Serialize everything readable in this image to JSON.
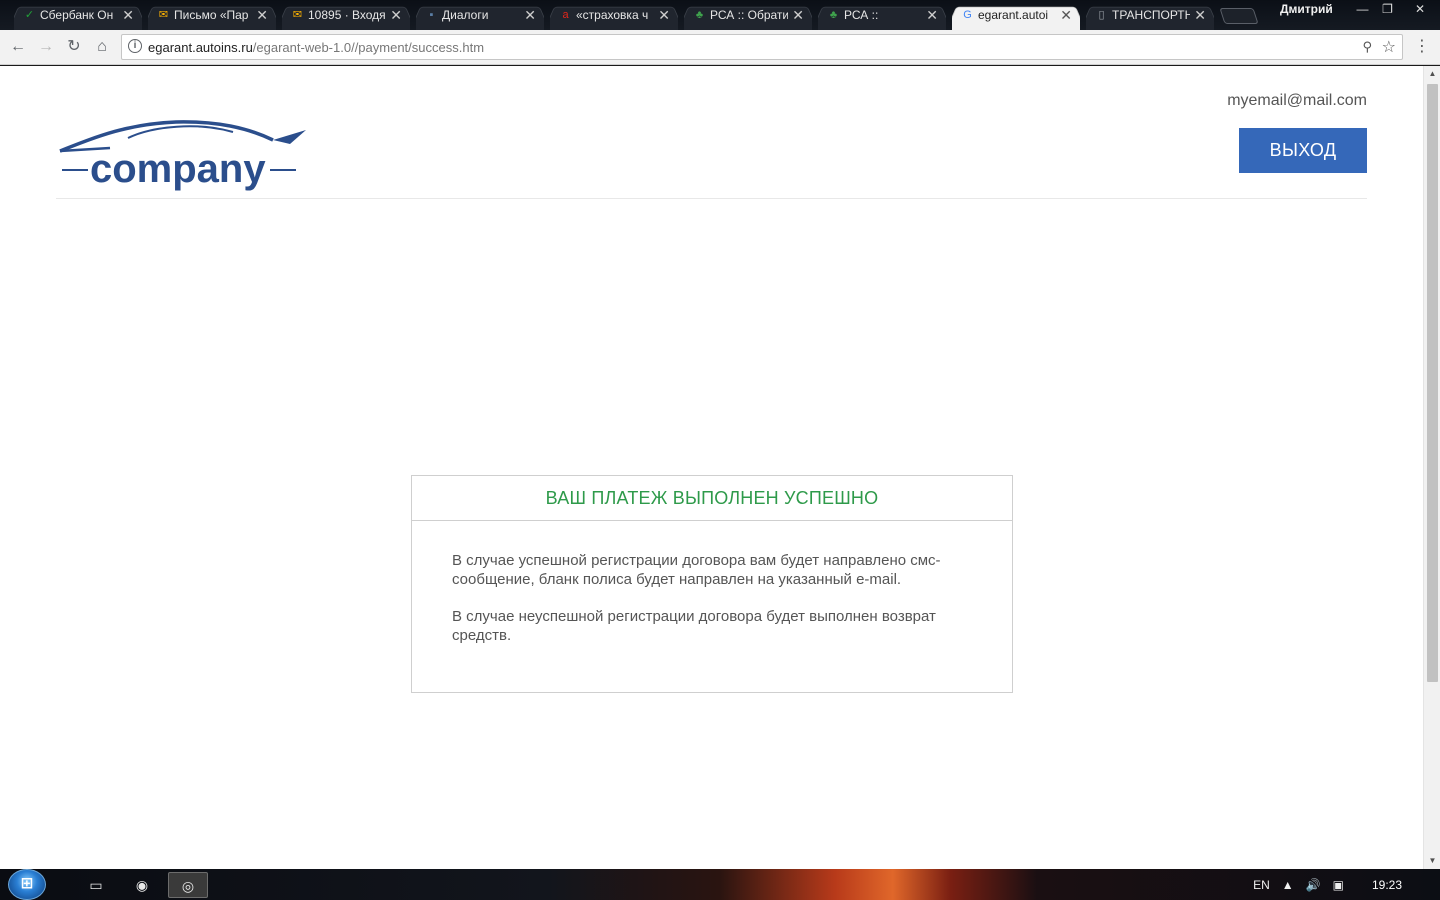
{
  "browser": {
    "tabs": [
      {
        "title": "Сбербанк Он",
        "favicon": "sberbank-icon",
        "favicon_color": "#21a038",
        "active": false
      },
      {
        "title": "Письмо «Пар",
        "favicon": "mail-icon",
        "favicon_color": "#ffb400",
        "active": false
      },
      {
        "title": "10895 · Входя",
        "favicon": "mail-icon",
        "favicon_color": "#ffb400",
        "active": false
      },
      {
        "title": "Диалоги",
        "favicon": "chat-icon",
        "favicon_color": "#5b7fa6",
        "active": false
      },
      {
        "title": "«страховка ч",
        "favicon": "la-icon",
        "favicon_color": "#e0261b",
        "active": false
      },
      {
        "title": "РСА :: Обрати",
        "favicon": "rsa-icon",
        "favicon_color": "#3fa34d",
        "active": false
      },
      {
        "title": "РСА ::",
        "favicon": "rsa-icon",
        "favicon_color": "#3fa34d",
        "active": false
      },
      {
        "title": "egarant.autoi",
        "favicon": "google-icon",
        "favicon_color": "#4285f4",
        "active": true
      },
      {
        "title": "ТРАНСПОРТН",
        "favicon": "document-icon",
        "favicon_color": "#9aa0a6",
        "active": false
      }
    ],
    "user_name": "Дмитрий",
    "url_domain": "egarant.autoins.ru",
    "url_path": "/egarant-web-1.0//payment/success.htm"
  },
  "page": {
    "user_email": "myemail@mail.com",
    "logout_label": "ВЫХОД",
    "logo_text": "company",
    "brand_color": "#2b4e8c",
    "success_color": "#2e9a4a",
    "panel": {
      "title": "ВАШ ПЛАТЕЖ ВЫПОЛНЕН УСПЕШНО",
      "paragraph_1": "В случае успешной регистрации договора вам будет направлено смс-сообщение, бланк полиса будет направлен на указанный e-mail.",
      "paragraph_2": "В случае неуспешной регистрации договора будет выполнен возврат средств."
    }
  },
  "taskbar": {
    "language": "EN",
    "time": "19:23"
  }
}
